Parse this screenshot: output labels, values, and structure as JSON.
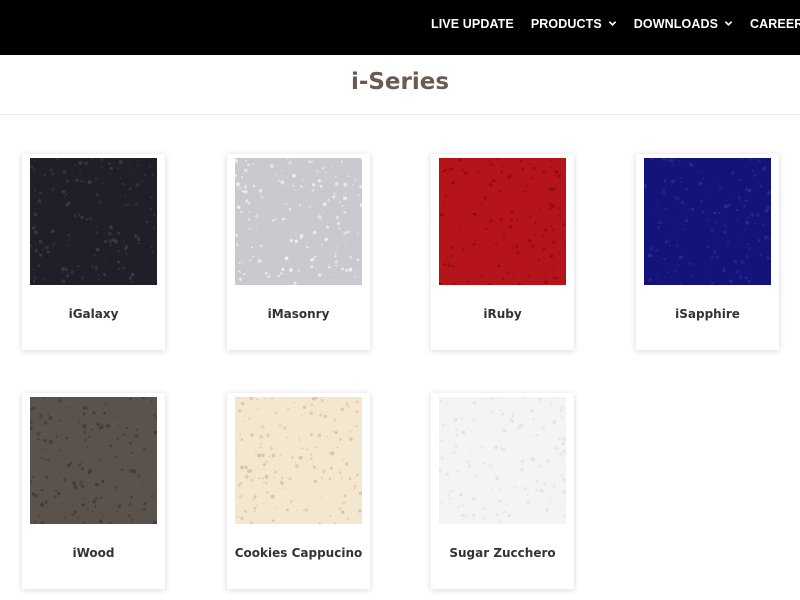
{
  "nav": {
    "items": [
      {
        "label": "LIVE UPDATE",
        "has_dropdown": false
      },
      {
        "label": "PRODUCTS",
        "has_dropdown": true
      },
      {
        "label": "DOWNLOADS",
        "has_dropdown": true
      },
      {
        "label": "CAREER OPPORTUNITIES",
        "has_dropdown": false
      }
    ]
  },
  "page": {
    "title": "i-Series"
  },
  "products": [
    {
      "name": "iGalaxy",
      "base_color": "#1e1f29",
      "speck_color": "#3b3d4a",
      "icon": "stone-swatch"
    },
    {
      "name": "iMasonry",
      "base_color": "#c9c9cf",
      "speck_color": "#f2f2f4",
      "icon": "stone-swatch"
    },
    {
      "name": "iRuby",
      "base_color": "#b5141a",
      "speck_color": "#8c0d12",
      "icon": "stone-swatch"
    },
    {
      "name": "iSapphire",
      "base_color": "#14137a",
      "speck_color": "#2a2aa0",
      "icon": "stone-swatch"
    },
    {
      "name": "iWood",
      "base_color": "#5a534b",
      "speck_color": "#3f3a34",
      "icon": "stone-swatch"
    },
    {
      "name": "Cookies Cappucino",
      "base_color": "#f4e7cf",
      "speck_color": "#d9bf97",
      "icon": "stone-swatch"
    },
    {
      "name": "Sugar Zucchero",
      "base_color": "#f4f4f6",
      "speck_color": "#e0e0e4",
      "icon": "stone-swatch"
    }
  ]
}
